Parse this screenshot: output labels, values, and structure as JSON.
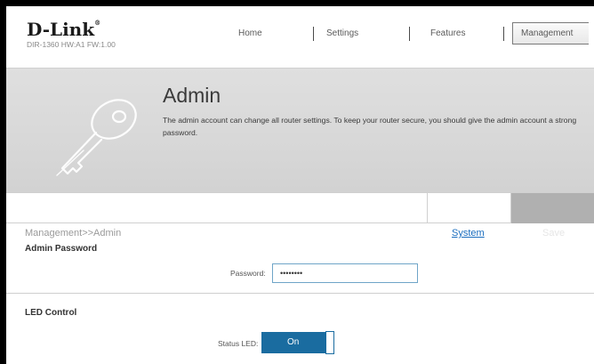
{
  "brand": {
    "logo": "D-Link",
    "registered_mark": "®",
    "model": "DIR-1360 HW:A1 FW:1.00"
  },
  "nav": {
    "home": "Home",
    "settings": "Settings",
    "features": "Features",
    "management": "Management",
    "active": "Management"
  },
  "banner": {
    "title": "Admin",
    "description": "The admin account can change all router settings. To keep your router secure, you should give the admin account a strong password.",
    "icon": "key-icon"
  },
  "breadcrumb": "Management>>Admin",
  "actions": {
    "system_label": "System",
    "save_label": "Save"
  },
  "admin_password": {
    "section_title": "Admin Password",
    "password_label": "Password:",
    "password_value": "••••••••"
  },
  "led_control": {
    "section_title": "LED Control",
    "status_led_label": "Status LED:",
    "status_led_value": "On"
  },
  "colors": {
    "accent": "#1a6ca0",
    "link": "#1a6dbf",
    "save_disabled": "#b0b0b0",
    "input_border": "#6fa5c8"
  }
}
